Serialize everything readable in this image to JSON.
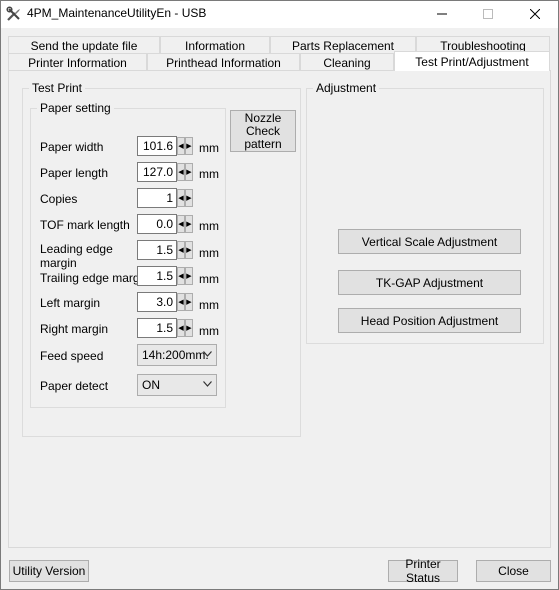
{
  "window": {
    "title": "4PM_MaintenanceUtilityEn - USB"
  },
  "tabs_row1": [
    "Send the update file",
    "Information",
    "Parts Replacement",
    "Troubleshooting"
  ],
  "tabs_row2": [
    "Printer Information",
    "Printhead Information",
    "Cleaning",
    "Test Print/Adjustment"
  ],
  "test_print": {
    "legend": "Test Print",
    "paper_setting": {
      "legend": "Paper setting",
      "paper_width": {
        "label": "Paper width",
        "value": "101.6",
        "unit": "mm"
      },
      "paper_length": {
        "label": "Paper length",
        "value": "127.0",
        "unit": "mm"
      },
      "copies": {
        "label": "Copies",
        "value": "1"
      },
      "tof_mark_length": {
        "label": "TOF mark length",
        "value": "0.0",
        "unit": "mm"
      },
      "leading_edge_margin": {
        "label_line1": "Leading edge",
        "label_line2": "margin",
        "value": "1.5",
        "unit": "mm"
      },
      "trailing_edge_margin": {
        "label": "Trailing edge margin",
        "value": "1.5",
        "unit": "mm"
      },
      "left_margin": {
        "label": "Left margin",
        "value": "3.0",
        "unit": "mm"
      },
      "right_margin": {
        "label": "Right margin",
        "value": "1.5",
        "unit": "mm"
      },
      "feed_speed": {
        "label": "Feed speed",
        "value": "14h:200mm."
      },
      "paper_detect": {
        "label": "Paper detect",
        "value": "ON"
      }
    },
    "nozzle_button": {
      "line1": "Nozzle",
      "line2": "Check",
      "line3": "pattern"
    }
  },
  "adjustment": {
    "legend": "Adjustment",
    "vertical_scale": "Vertical Scale Adjustment",
    "tk_gap": "TK-GAP Adjustment",
    "head_position": "Head Position Adjustment"
  },
  "footer": {
    "utility_version": "Utility Version",
    "printer_status": "Printer Status",
    "close": "Close"
  }
}
